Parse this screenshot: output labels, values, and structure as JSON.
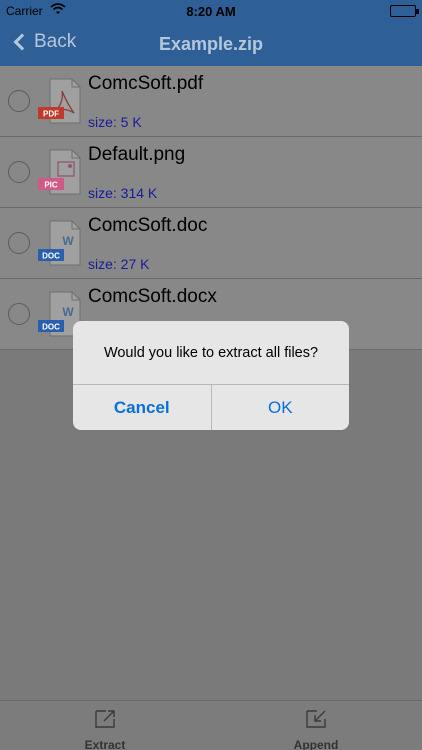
{
  "status": {
    "carrier": "Carrier",
    "time": "8:20 AM"
  },
  "nav": {
    "back_label": "Back",
    "title": "Example.zip"
  },
  "files": [
    {
      "name": "ComcSoft.pdf",
      "size": "size: 5 K",
      "badge": "PDF",
      "badge_color": "#c0392b"
    },
    {
      "name": "Default.png",
      "size": "size: 314 K",
      "badge": "PIC",
      "badge_color": "#d05a87"
    },
    {
      "name": "ComcSoft.doc",
      "size": "size: 27 K",
      "badge": "DOC",
      "badge_color": "#2a5fae"
    },
    {
      "name": "ComcSoft.docx",
      "size": "",
      "badge": "DOC",
      "badge_color": "#2a5fae"
    }
  ],
  "dialog": {
    "message": "Would you like to extract all files?",
    "cancel": "Cancel",
    "ok": "OK"
  },
  "tabs": {
    "extract": "Extract",
    "append": "Append"
  },
  "colors": {
    "nav_bg": "#2f5f97",
    "accent": "#0a6fd8",
    "overlay": "#7a7a7a"
  }
}
